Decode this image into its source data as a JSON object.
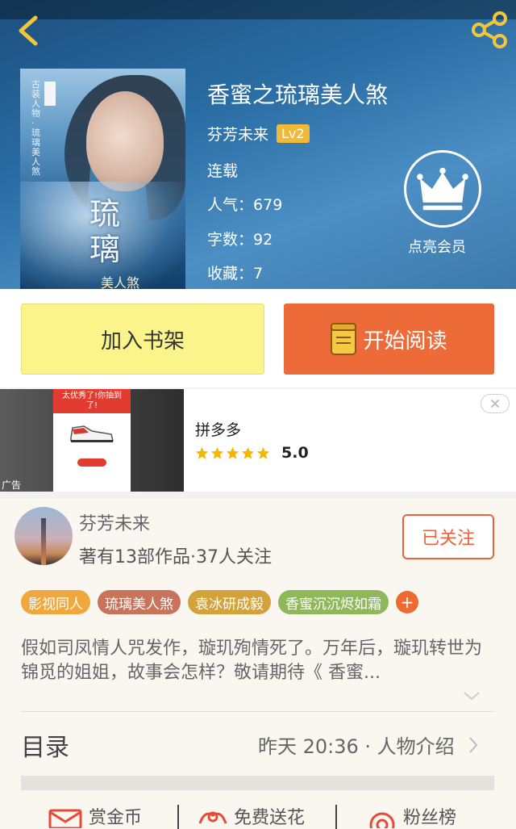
{
  "header": {
    "back_icon": "chevron-left-icon",
    "share_icon": "share-icon"
  },
  "book": {
    "cover_credit": "古装人物·琉璃美人煞",
    "cover_title": "琉璃",
    "cover_subtitle": "美人煞",
    "title": "香蜜之琉璃美人煞",
    "author": "芬芳未来",
    "level": "Lv2",
    "status": "连载",
    "popularity_label": "人气：",
    "popularity": "679",
    "words_label": "字数：",
    "words": "92",
    "favorites_label": "收藏：",
    "favorites": "7"
  },
  "vip": {
    "label": "点亮会员",
    "icon": "crown-icon"
  },
  "actions": {
    "add_shelf": "加入书架",
    "start_read": "开始阅读"
  },
  "ad": {
    "poster_text": "太优秀了!你抽到了!",
    "mark": "广告",
    "name": "拼多多",
    "rating": "5.0",
    "stars": 5
  },
  "author_card": {
    "name": "芬芳未来",
    "stats": "著有13部作品·37人关注",
    "follow": "已关注"
  },
  "tags": [
    {
      "label": "影视同人",
      "color": "#f0a83c"
    },
    {
      "label": "琉璃美人煞",
      "color": "#c9735a"
    },
    {
      "label": "袁冰研成毅",
      "color": "#d4a23a"
    },
    {
      "label": "香蜜沉沉烬如霜",
      "color": "#8fb85a"
    }
  ],
  "tag_add": "+",
  "intro": "假如司凤情人咒发作，璇玑殉情死了。万年后，璇玑转世为锦觅的姐姐，故事会怎样？敬请期待《 香蜜...",
  "toc": {
    "label": "目录",
    "info": "昨天 20:36 · 人物介绍"
  },
  "bottom_bar": {
    "reward": "赏金币",
    "flower": "免费送花",
    "fans": "粉丝榜"
  },
  "colors": {
    "accent_orange": "#ed6b38",
    "shelf_yellow": "#fbf48a",
    "badge_gold": "#f0b93a"
  }
}
